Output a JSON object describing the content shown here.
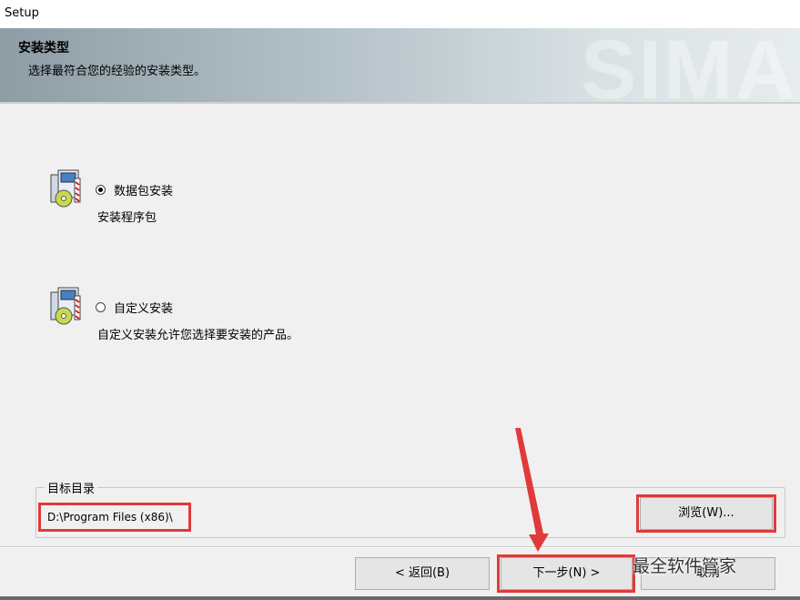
{
  "window": {
    "title": "Setup"
  },
  "header": {
    "title": "安装类型",
    "subtitle": "选择最符合您的经验的安装类型。",
    "watermark": "SIMA"
  },
  "options": [
    {
      "label": "数据包安装",
      "description": "安装程序包",
      "selected": true
    },
    {
      "label": "自定义安装",
      "description": "自定义安装允许您选择要安装的产品。",
      "selected": false
    }
  ],
  "target": {
    "group_label": "目标目录",
    "path": "D:\\Program Files (x86)\\",
    "browse_label": "浏览(W)..."
  },
  "buttons": {
    "back_label": "< 返回(B)",
    "next_label": "下一步(N) >",
    "cancel_label": "取消"
  },
  "overlay": {
    "watermark_text": "最全软件管家"
  },
  "colors": {
    "highlight": "#e03a3a",
    "arrow": "#e03a3a"
  }
}
